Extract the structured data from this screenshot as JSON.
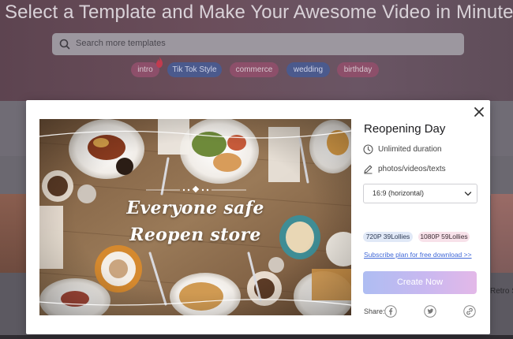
{
  "background": {
    "title": "Select a Template and Make Your Awesome Video in Minutes",
    "search": {
      "placeholder": "Search more templates"
    },
    "tags": [
      {
        "label": "intro"
      },
      {
        "label": "Tik Tok Style"
      },
      {
        "label": "commerce"
      },
      {
        "label": "wedding"
      },
      {
        "label": "birthday"
      }
    ],
    "right_label": "Retro S"
  },
  "modal": {
    "preview": {
      "overlay_line1": "Everyone safe",
      "overlay_line2": "Reopen store"
    },
    "template_title": "Reopening Day",
    "duration_text": "Unlimited duration",
    "media_text": "photos/videos/texts",
    "aspect_select": {
      "selected": "16:9 (horizontal)"
    },
    "prices": [
      {
        "label": "720P 39Lollies"
      },
      {
        "label": "1080P 59Lollies"
      }
    ],
    "subscribe_link": "Subscribe plan for free download >>",
    "create_button": "Create Now",
    "share_label": "Share:",
    "share_icons": [
      "facebook-icon",
      "twitter-icon",
      "link-icon"
    ]
  },
  "colors": {
    "accent_gradient_start": "#aebdf2",
    "accent_gradient_end": "#e3b8e8",
    "link": "#4169d8",
    "price_720_bg": "#e1e9f7",
    "price_1080_bg": "#f8e2ea"
  }
}
